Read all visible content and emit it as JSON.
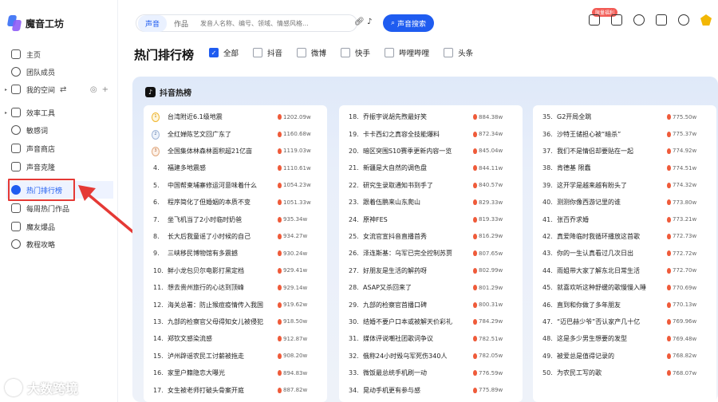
{
  "app": {
    "name": "魔音工坊"
  },
  "sidebar": {
    "items": [
      {
        "label": "主页",
        "icon": "home-icon"
      },
      {
        "label": "团队成员",
        "icon": "team-icon"
      },
      {
        "label": "我的空间",
        "icon": "folder-icon"
      },
      {
        "label": "效率工具",
        "icon": "tools-icon"
      },
      {
        "label": "敏感词",
        "icon": "search-icon"
      },
      {
        "label": "声音商店",
        "icon": "store-icon"
      },
      {
        "label": "声音克隆",
        "icon": "clone-icon"
      },
      {
        "label": "热门排行榜",
        "icon": "hot-icon",
        "active": true
      },
      {
        "label": "每周热门作品",
        "icon": "weekly-icon"
      },
      {
        "label": "魔友爆品",
        "icon": "chat-icon"
      },
      {
        "label": "教程攻略",
        "icon": "guide-icon"
      }
    ]
  },
  "topbar": {
    "tabs": [
      "声音",
      "作品"
    ],
    "search_placeholder": "发音人名称、编号、领域、情感风格...",
    "search_button": "声音搜索",
    "badge": "限量福利"
  },
  "page": {
    "title": "热门排行榜",
    "filters": [
      {
        "label": "全部",
        "checked": true
      },
      {
        "label": "抖音",
        "checked": false
      },
      {
        "label": "微博",
        "checked": false
      },
      {
        "label": "快手",
        "checked": false
      },
      {
        "label": "哔哩哔哩",
        "checked": false
      },
      {
        "label": "头条",
        "checked": false
      }
    ],
    "panel_title": "抖音热榜"
  },
  "columns": [
    [
      {
        "rank": "1",
        "title": "台湾附近6.1级地震",
        "hot": "1202.09w"
      },
      {
        "rank": "2",
        "title": "全红婵陈艺文回广东了",
        "hot": "1160.68w"
      },
      {
        "rank": "3",
        "title": "全国集体林森林面积超21亿亩",
        "hot": "1119.03w"
      },
      {
        "rank": "4.",
        "title": "福建多地震感",
        "hot": "1110.61w"
      },
      {
        "rank": "5.",
        "title": "中国帮柬埔寨修运河意味着什么",
        "hot": "1054.23w"
      },
      {
        "rank": "6.",
        "title": "程序简化了但婚姻的本质不变",
        "hot": "1051.33w"
      },
      {
        "rank": "7.",
        "title": "坐飞机当了2小时临时奶爸",
        "hot": "935.34w"
      },
      {
        "rank": "8.",
        "title": "长大后我童谣了小时候的自己",
        "hot": "934.27w"
      },
      {
        "rank": "9.",
        "title": "三峡移民博物馆有多震撼",
        "hot": "930.24w"
      },
      {
        "rank": "10.",
        "title": "鲜小龙包贝尔电影打黑定档",
        "hot": "929.41w"
      },
      {
        "rank": "11.",
        "title": "想去贵州旅行的心达到顶峰",
        "hot": "929.14w"
      },
      {
        "rank": "12.",
        "title": "海关总署：防止猴痘疫情传入我国",
        "hot": "919.62w"
      },
      {
        "rank": "13.",
        "title": "九部的检察官父母得知女儿被侵犯",
        "hot": "918.50w"
      },
      {
        "rank": "14.",
        "title": "郑钦文感染流感",
        "hot": "912.87w"
      },
      {
        "rank": "15.",
        "title": "泸州辟谣农民工讨薪被拖走",
        "hot": "908.20w"
      },
      {
        "rank": "16.",
        "title": "家里户籍隐恋大曝光",
        "hot": "894.83w"
      },
      {
        "rank": "17.",
        "title": "女生被老师打破头骨案开庭",
        "hot": "887.82w"
      }
    ],
    [
      {
        "rank": "18.",
        "title": "乔振宇说胡先煦最好笑",
        "hot": "884.38w"
      },
      {
        "rank": "19.",
        "title": "卡卡西幻之真容全技能爆料",
        "hot": "872.34w"
      },
      {
        "rank": "20.",
        "title": "暗区突围S10赛季更新内容一览",
        "hot": "845.04w"
      },
      {
        "rank": "21.",
        "title": "新疆是大自然的调色盘",
        "hot": "844.11w"
      },
      {
        "rank": "22.",
        "title": "研究生录取通知书到手了",
        "hot": "840.57w"
      },
      {
        "rank": "23.",
        "title": "跟着伍鹏来山东爬山",
        "hot": "829.33w"
      },
      {
        "rank": "24.",
        "title": "原神FES",
        "hot": "819.33w"
      },
      {
        "rank": "25.",
        "title": "女流官宣抖音直播首秀",
        "hot": "816.29w"
      },
      {
        "rank": "26.",
        "title": "泽连斯基：乌军已完全控制苏贾",
        "hot": "807.65w"
      },
      {
        "rank": "27.",
        "title": "好朋友是生活的解药呀",
        "hot": "802.99w"
      },
      {
        "rank": "28.",
        "title": "ASAP又杀回来了",
        "hot": "801.29w"
      },
      {
        "rank": "29.",
        "title": "九部的检察官首播口碑",
        "hot": "800.31w"
      },
      {
        "rank": "30.",
        "title": "结婚不要户口本或被解天价彩礼",
        "hot": "784.29w"
      },
      {
        "rank": "31.",
        "title": "媒体评说嘲社团歌词争议",
        "hot": "782.51w"
      },
      {
        "rank": "32.",
        "title": "俄称24小时毁乌军死伤340人",
        "hot": "782.05w"
      },
      {
        "rank": "33.",
        "title": "微饭最总统手机刷一动",
        "hot": "776.59w"
      },
      {
        "rank": "34.",
        "title": "晃动手机更有参与感",
        "hot": "775.89w"
      }
    ],
    [
      {
        "rank": "35.",
        "title": "G2开局全跳",
        "hot": "775.50w"
      },
      {
        "rank": "36.",
        "title": "沙特王储担心被“暗杀”",
        "hot": "775.37w"
      },
      {
        "rank": "37.",
        "title": "我们不是情侣却要贴在一起",
        "hot": "774.92w"
      },
      {
        "rank": "38.",
        "title": "肯德基 限蠢",
        "hot": "774.51w"
      },
      {
        "rank": "39.",
        "title": "这开学是越来越有盼头了",
        "hot": "774.32w"
      },
      {
        "rank": "40.",
        "title": "测测你像西游记里的谁",
        "hot": "773.80w"
      },
      {
        "rank": "41.",
        "title": "张百乔求婚",
        "hot": "773.21w"
      },
      {
        "rank": "42.",
        "title": "真爱降临时我循环播放这首歌",
        "hot": "772.73w"
      },
      {
        "rank": "43.",
        "title": "你的一生认真看过几次日出",
        "hot": "772.72w"
      },
      {
        "rank": "44.",
        "title": "雨姐带大家了解东北日常生活",
        "hot": "772.70w"
      },
      {
        "rank": "45.",
        "title": "就喜欢听这种舒缓的歌慢慢入睡",
        "hot": "770.69w"
      },
      {
        "rank": "46.",
        "title": "直到和你做了多年朋友",
        "hot": "770.13w"
      },
      {
        "rank": "47.",
        "title": "“迈巴赫少爷”否认家产几十亿",
        "hot": "769.96w"
      },
      {
        "rank": "48.",
        "title": "这是多少男生想要的发型",
        "hot": "769.48w"
      },
      {
        "rank": "49.",
        "title": "被爱总是值得记录的",
        "hot": "768.82w"
      },
      {
        "rank": "50.",
        "title": "为农民工写的歌",
        "hot": "768.07w"
      }
    ]
  ],
  "watermark": {
    "text": "大数跨境"
  },
  "colors": {
    "accent": "#1f5cf0",
    "highlight": "#e53935",
    "flame": "#ef5b3a"
  }
}
